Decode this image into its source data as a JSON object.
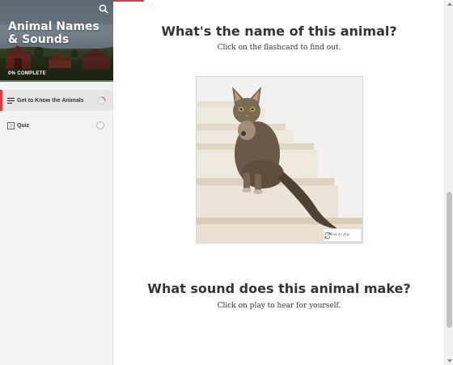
{
  "sidebar": {
    "course_title": "Animal Names & Sounds",
    "progress_text": "0% COMPLETE",
    "progress_percent": 0,
    "lessons": [
      {
        "label": "Get to Know the Animals",
        "icon": "text-lines-icon",
        "active": true
      },
      {
        "label": "Quiz",
        "icon": "quiz-icon",
        "active": false
      }
    ]
  },
  "main": {
    "heading1": "What's the name of this animal?",
    "subtext1": "Click on the flashcard to find out.",
    "flashcard": {
      "hint": "Click to flip",
      "image": "cat-on-stairs"
    },
    "heading2": "What sound does this animal make?",
    "subtext2": "Click on play to hear for yourself."
  },
  "colors": {
    "accent": "#e0393e",
    "heading": "#313537",
    "sidebar_bg": "#f2f2f2"
  }
}
